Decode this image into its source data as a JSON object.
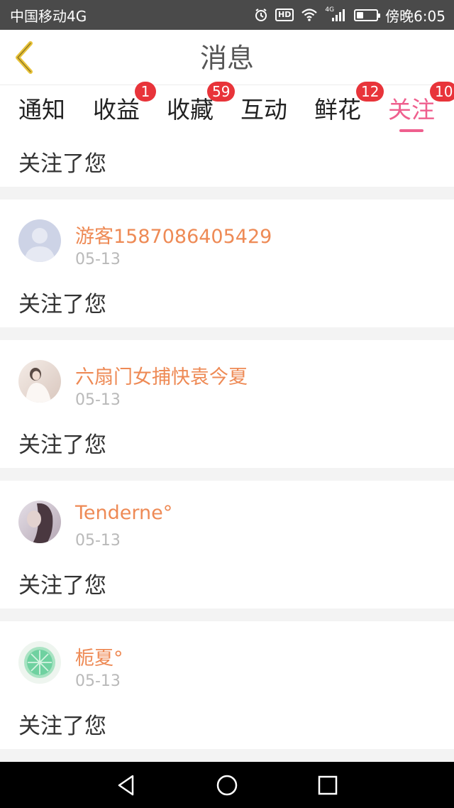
{
  "status_bar": {
    "carrier": "中国移动4G",
    "alarm_icon": "alarm-clock-icon",
    "hd_label": "HD",
    "wifi_icon": "wifi-icon",
    "network_label": "4G",
    "signal_icon": "signal-bars-icon",
    "battery_icon": "battery-icon",
    "battery_level": 0.35,
    "time": "傍晚6:05"
  },
  "header": {
    "title": "消息",
    "back_icon": "chevron-left-icon",
    "back_color": "#e8c33a"
  },
  "tabs": [
    {
      "label": "通知",
      "badge": ""
    },
    {
      "label": "收益",
      "badge": "1"
    },
    {
      "label": "收藏",
      "badge": "59"
    },
    {
      "label": "互动",
      "badge": ""
    },
    {
      "label": "鲜花",
      "badge": "12"
    },
    {
      "label": "关注",
      "badge": "10",
      "active": true
    }
  ],
  "feed": {
    "partial_top": {
      "message": "关注了您"
    },
    "items": [
      {
        "nickname": "游客1587086405429",
        "date": "05-13",
        "message": "关注了您",
        "avatar": "default-user-avatar"
      },
      {
        "nickname": "六扇门女捕快袁今夏",
        "date": "05-13",
        "message": "关注了您",
        "avatar": "photo-avatar-girl"
      },
      {
        "nickname": "Tenderne°",
        "date": "05-13",
        "message": "关注了您",
        "avatar": "photo-avatar-portrait"
      },
      {
        "nickname": "栀夏°",
        "date": "05-13",
        "message": "关注了您",
        "avatar": "lime-slice-avatar"
      }
    ]
  },
  "colors": {
    "accent": "#ef5f8e",
    "badge": "#e8343a",
    "nickname": "#ee8a55",
    "status_bar": "#4a4a4a"
  },
  "nav_bar": {
    "back_icon": "triangle-back-icon",
    "home_icon": "circle-home-icon",
    "recents_icon": "square-recents-icon"
  }
}
